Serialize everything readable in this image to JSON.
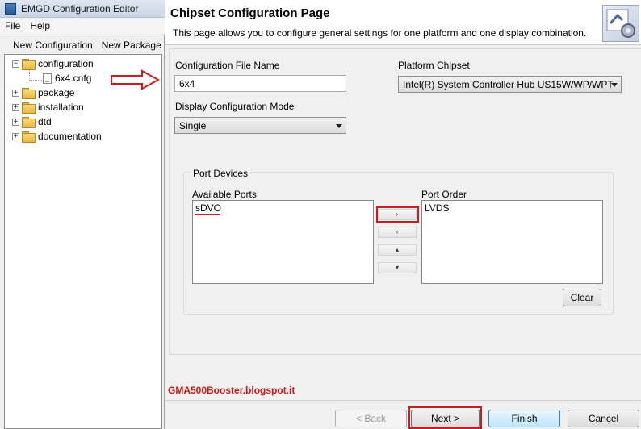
{
  "app": {
    "title": "EMGD Configuration Editor",
    "menu": [
      "File",
      "Help"
    ],
    "toolbar": [
      "New Configuration",
      "New Package"
    ]
  },
  "tree": {
    "nodes": [
      {
        "label": "configuration",
        "expander": "−"
      },
      {
        "label": "6x4.cnfg"
      },
      {
        "label": "package",
        "expander": "+"
      },
      {
        "label": "installation",
        "expander": "+"
      },
      {
        "label": "dtd",
        "expander": "+"
      },
      {
        "label": "documentation",
        "expander": "+"
      }
    ]
  },
  "wizard": {
    "title": "Chipset Configuration Page",
    "description": "This page allows you to configure general settings for one platform and one display combination.",
    "config_file_label": "Configuration File Name",
    "config_file_value": "6x4",
    "platform_label": "Platform Chipset",
    "platform_value": "Intel(R) System Controller Hub US15W/WP/WPT",
    "display_mode_label": "Display Configuration Mode",
    "display_mode_value": "Single",
    "port_devices_label": "Port Devices",
    "available_ports_label": "Available Ports",
    "available_ports": [
      "sDVO"
    ],
    "port_order_label": "Port Order",
    "port_order": [
      "LVDS"
    ],
    "move_buttons": [
      "›",
      "‹",
      "▴",
      "▾"
    ],
    "clear_label": "Clear",
    "back_label": "< Back",
    "next_label": "Next >",
    "finish_label": "Finish",
    "cancel_label": "Cancel"
  },
  "watermark": "GMA500Booster.blogspot.it",
  "colors": {
    "annotation_red": "#cc1d1d",
    "watermark_red": "#c81818"
  }
}
